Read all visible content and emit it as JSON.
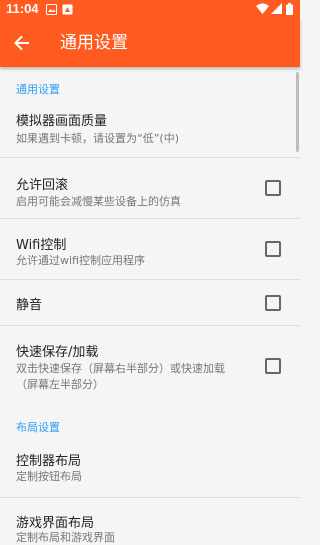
{
  "status_bar": {
    "time": "11:04",
    "icons": [
      "image-icon",
      "notification-icon",
      "wifi-icon",
      "signal-icon",
      "battery-icon"
    ]
  },
  "app_bar": {
    "title": "通用设置",
    "back_icon": "arrow-back-icon"
  },
  "colors": {
    "accent": "#ff5a1f",
    "section": "#2ba0f2"
  },
  "sections": [
    {
      "header": "通用设置",
      "items": [
        {
          "title": "模拟器画面质量",
          "summary": "如果遇到卡顿，请设置为“低”(中)"
        },
        {
          "title": "允许回滚",
          "summary": "启用可能会减慢某些设备上的仿真",
          "checked": false
        },
        {
          "title": "Wifi控制",
          "summary": "允许通过wifi控制应用程序",
          "checked": false
        },
        {
          "title": "静音",
          "checked": false
        },
        {
          "title": "快速保存/加载",
          "summary_line1": "双击快速保存（屏幕右半部分）或快速加载",
          "summary_line2": "（屏幕左半部分）",
          "checked": false
        }
      ]
    },
    {
      "header": "布局设置",
      "items": [
        {
          "title": "控制器布局",
          "summary": "定制按钮布局"
        },
        {
          "title": "游戏界面布局",
          "summary": "定制布局和游戏界面"
        }
      ]
    }
  ]
}
